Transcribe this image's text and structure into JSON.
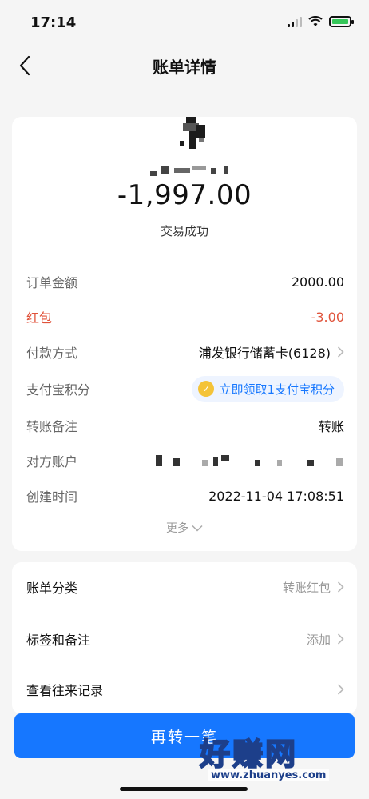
{
  "status_bar": {
    "time": "17:14"
  },
  "nav": {
    "title": "账单详情"
  },
  "summary": {
    "amount": "-1,997.00",
    "status": "交易成功"
  },
  "details": [
    {
      "label": "订单金额",
      "value": "2000.00"
    },
    {
      "label": "红包",
      "value": "-3.00"
    },
    {
      "label": "付款方式",
      "value": "浦发银行储蓄卡(6128)"
    },
    {
      "label": "支付宝积分",
      "value": "立即领取1支付宝积分"
    },
    {
      "label": "转账备注",
      "value": "转账"
    },
    {
      "label": "对方账户",
      "value": ""
    },
    {
      "label": "创建时间",
      "value": "2022-11-04 17:08:51"
    }
  ],
  "more_label": "更多",
  "extra_rows": [
    {
      "label": "账单分类",
      "value": "转账红包"
    },
    {
      "label": "标签和备注",
      "value": "添加"
    },
    {
      "label": "查看往来记录",
      "value": ""
    }
  ],
  "primary_button": "再转一笔",
  "watermark": {
    "text": "好赚网",
    "url": "www.zhuanyes.com"
  },
  "colors": {
    "accent": "#1677ff",
    "red": "#e0533b",
    "battery": "#35c759"
  }
}
